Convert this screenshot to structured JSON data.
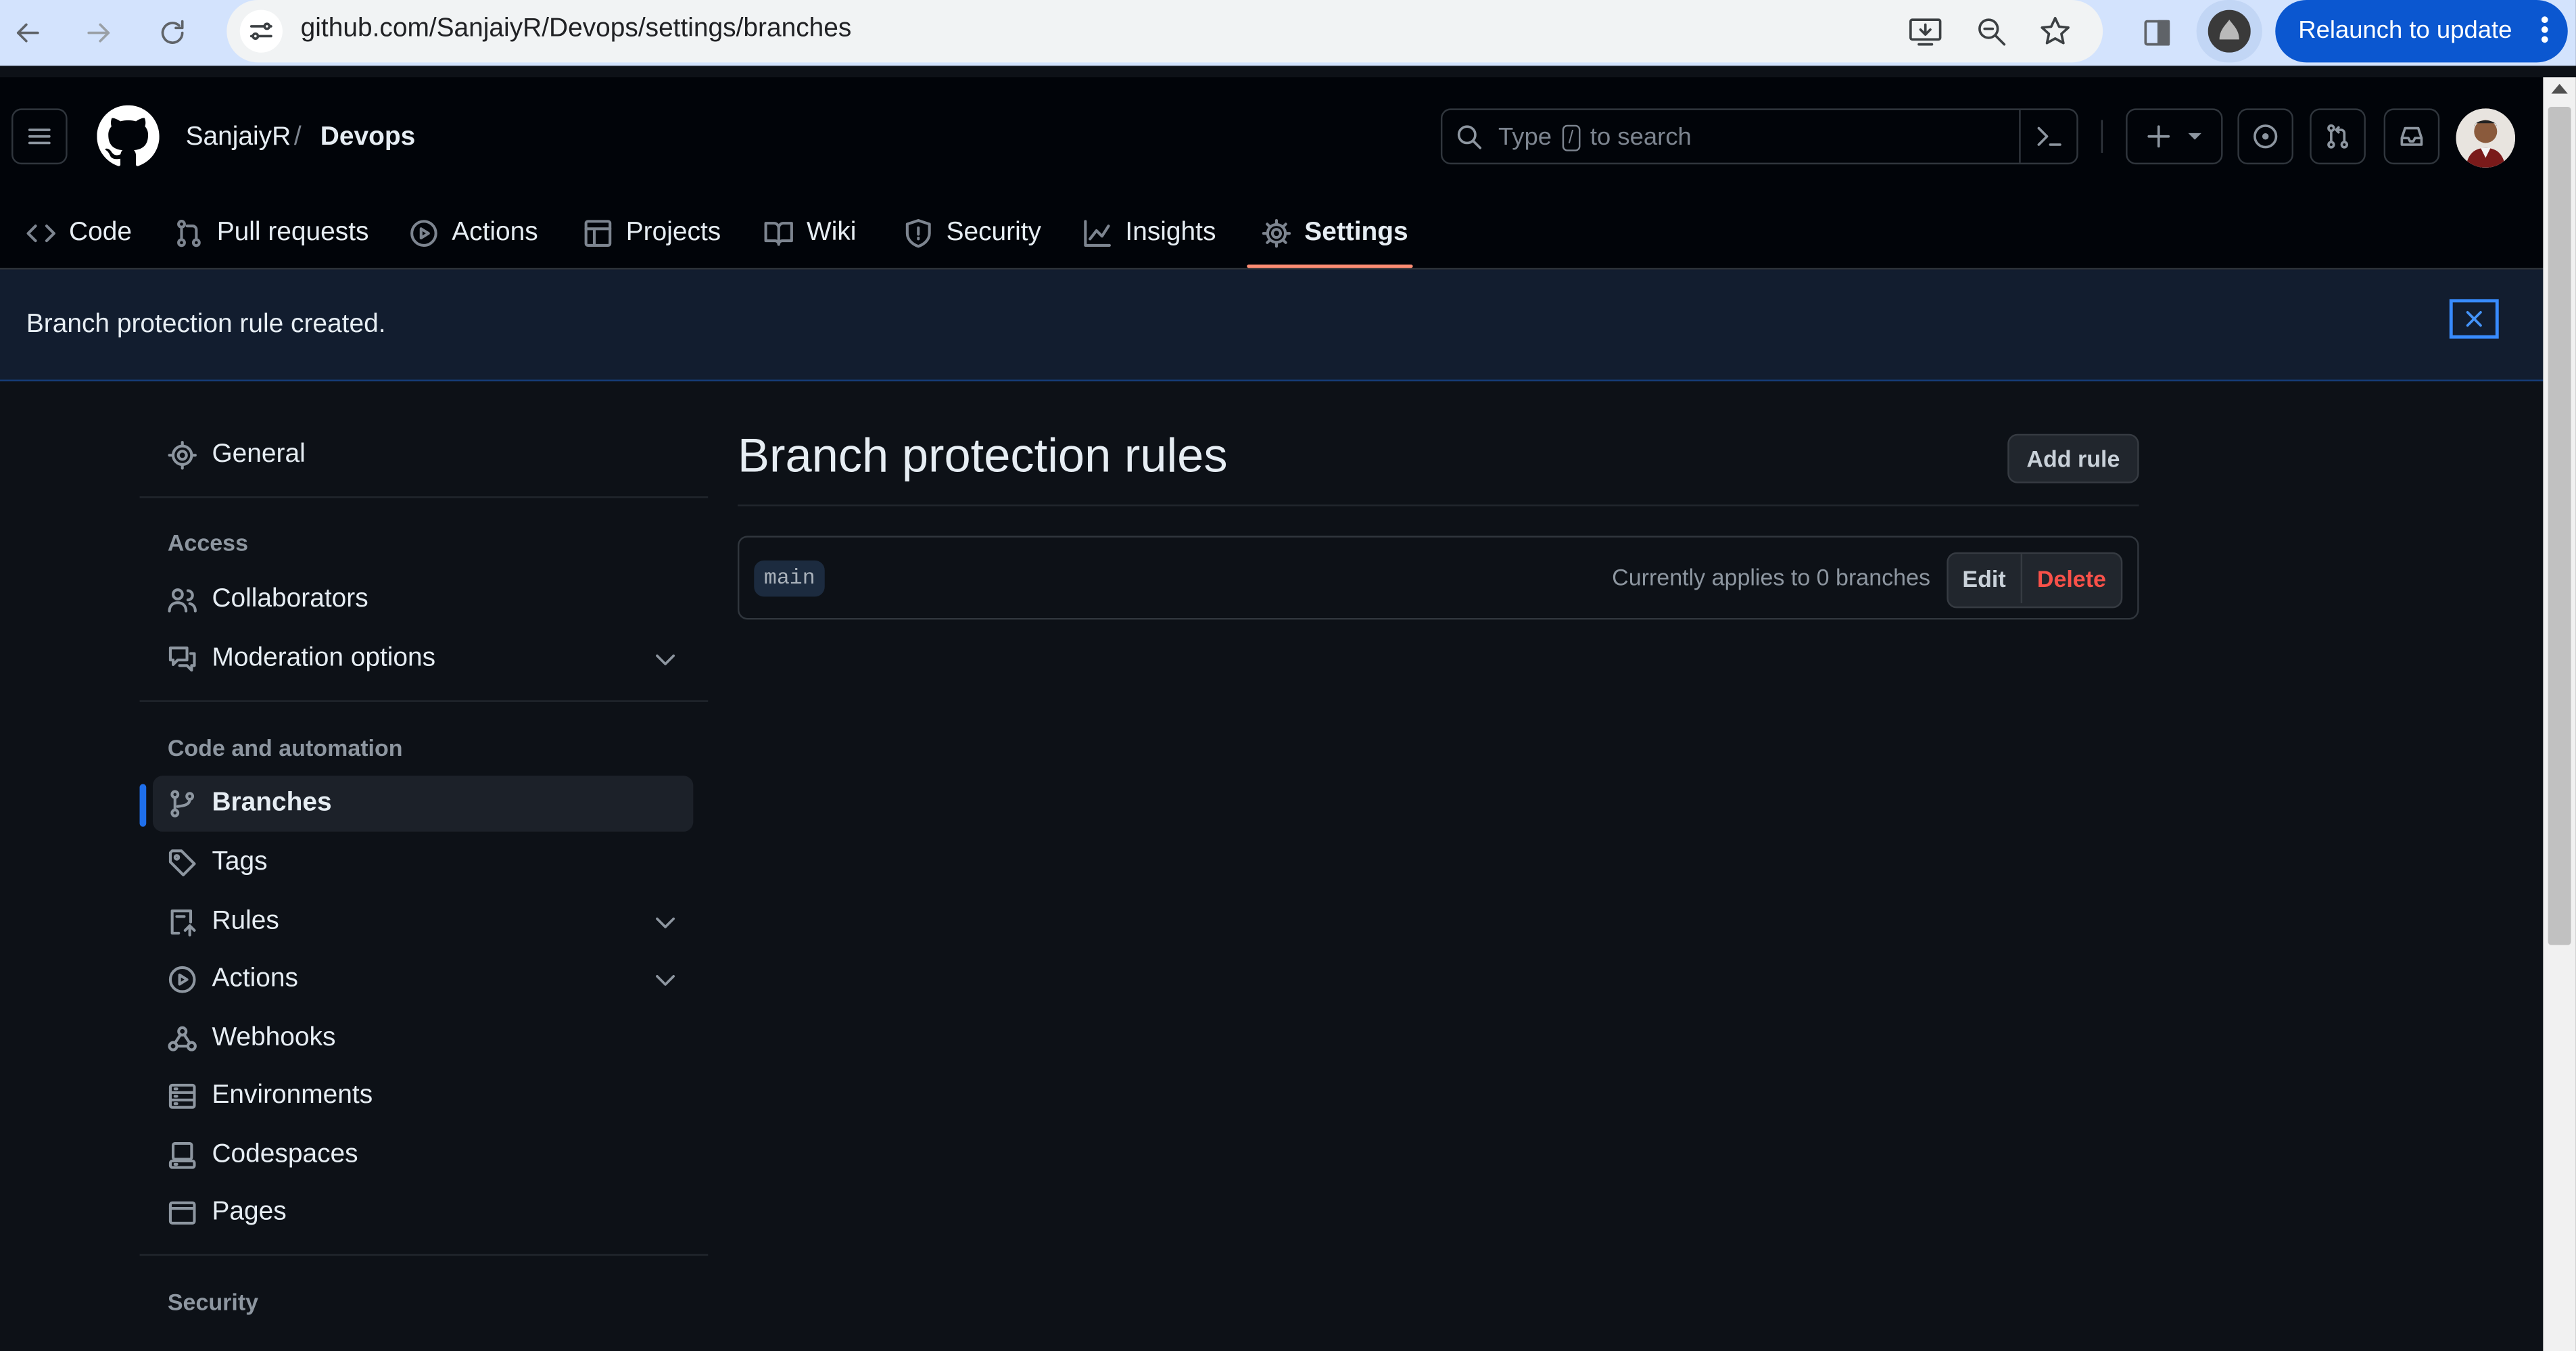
{
  "browser": {
    "url": "github.com/SanjaiyR/Devops/settings/branches",
    "relaunch_label": "Relaunch to update"
  },
  "repo": {
    "owner": "SanjaiyR",
    "separator": "/",
    "name": "Devops"
  },
  "search": {
    "placeholder_prefix": "Type",
    "key": "/",
    "placeholder_suffix": "to search"
  },
  "tabs": [
    {
      "label": "Code",
      "icon": "code-icon"
    },
    {
      "label": "Pull requests",
      "icon": "git-pull-request-icon"
    },
    {
      "label": "Actions",
      "icon": "play-icon"
    },
    {
      "label": "Projects",
      "icon": "table-icon"
    },
    {
      "label": "Wiki",
      "icon": "book-icon"
    },
    {
      "label": "Security",
      "icon": "shield-icon"
    },
    {
      "label": "Insights",
      "icon": "graph-icon"
    },
    {
      "label": "Settings",
      "icon": "gear-icon",
      "active": true
    }
  ],
  "flash": {
    "message": "Branch protection rule created."
  },
  "sidebar": {
    "general": "General",
    "access_heading": "Access",
    "access_items": [
      "Collaborators",
      "Moderation options"
    ],
    "code_heading": "Code and automation",
    "code_items": [
      "Branches",
      "Tags",
      "Rules",
      "Actions",
      "Webhooks",
      "Environments",
      "Codespaces",
      "Pages"
    ],
    "active_item": "Branches",
    "security_heading": "Security"
  },
  "main": {
    "title": "Branch protection rules",
    "add_rule_label": "Add rule",
    "rules": [
      {
        "branch": "main",
        "applies": "Currently applies to 0 branches",
        "edit_label": "Edit",
        "delete_label": "Delete"
      }
    ]
  },
  "colors": {
    "background": "#0d1117",
    "header": "#010409",
    "accent_underline": "#fd8c73",
    "active_bar": "#1f6feb",
    "danger": "#f85149",
    "relaunch": "#0b57d0"
  }
}
